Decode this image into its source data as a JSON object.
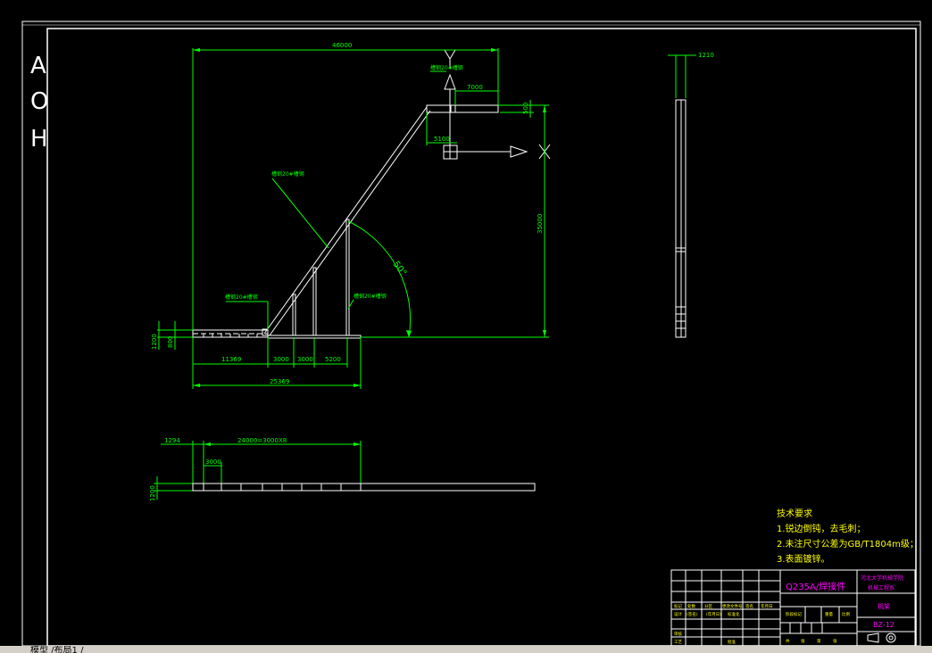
{
  "sheet": {
    "side_mark": [
      "A",
      "O",
      "H"
    ]
  },
  "dimensions": {
    "top_width": "46000",
    "top_right_len": "7000",
    "small_offset": "500",
    "inner_offset": "5100",
    "height": "35000",
    "angle": "50°",
    "base_left_h1": "1200",
    "base_left_h2": "800",
    "seg1": "11369",
    "seg2": "3000",
    "seg3": "3000",
    "seg4": "5200",
    "total": "25369",
    "side_width": "1210",
    "bottom_left": "1294",
    "bottom_pitch": "24000=3000X8",
    "bottom_small": "3000",
    "bottom_h": "1200"
  },
  "callouts": {
    "c1": "槽钢20#槽钢",
    "c2": "槽钢20#槽钢",
    "c3": "槽钢20#槽钢",
    "c4": "槽钢20#槽钢"
  },
  "notes": {
    "title": "技术要求",
    "items": [
      "1.锐边倒钝，去毛刺；",
      "2.未注尺寸公差为GB/T1804m级；",
      "3.表面镀锌。"
    ]
  },
  "title_block": {
    "material": "Q235A/焊接件",
    "school": "河北大学机械学院",
    "dept": "机械工程系",
    "part_name": "机架",
    "drawing_no": "BZ-12",
    "row_labels_a": [
      "标记",
      "处数",
      "分区",
      "更改文件号",
      "签名",
      "年月日"
    ],
    "row_labels_b": [
      "设计",
      "(签名)",
      "(年月日)",
      "标准化"
    ],
    "row_labels_c": [
      "审核"
    ],
    "row_labels_d": [
      "工艺",
      "批准"
    ],
    "stage_labels": [
      "阶段标记",
      "重量",
      "比例"
    ],
    "sheet_labels": [
      "共",
      "张",
      "第",
      "张"
    ]
  },
  "status_bar": {
    "tabs_text": "模型 /布局1 /"
  },
  "colors": {
    "background": "#000000",
    "line": "#ffffff",
    "dimension": "#00ff00",
    "note_text": "#ffff00",
    "material_text": "#ff00ff"
  }
}
